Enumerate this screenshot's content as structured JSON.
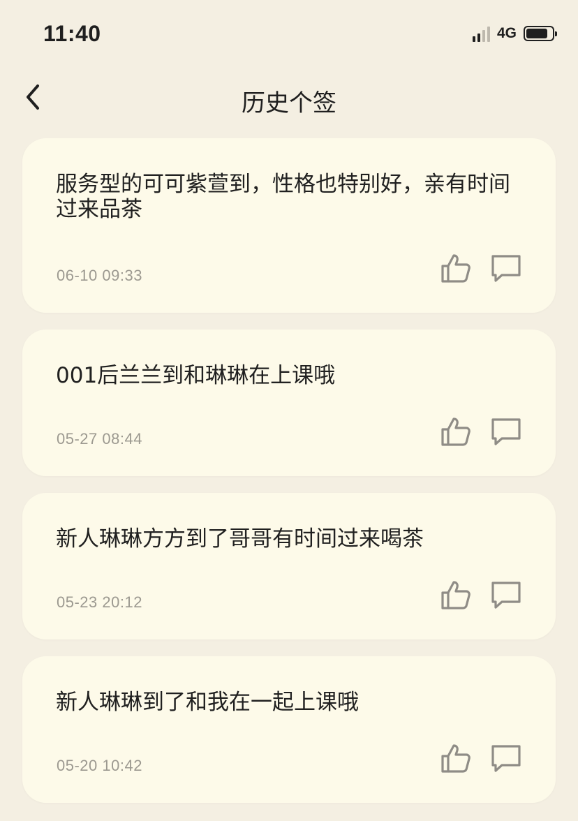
{
  "status_bar": {
    "time": "11:40",
    "network": "4G"
  },
  "header": {
    "title": "历史个签"
  },
  "icons": {
    "back": "chevron-left-icon",
    "like": "thumbs-up-icon",
    "comment": "comment-icon"
  },
  "colors": {
    "background": "#f4efe2",
    "card": "#fdfae9",
    "date_text": "#9c9990",
    "icon_gray": "#8f8c86"
  },
  "signatures": [
    {
      "text": "服务型的可可紫萱到，性格也特别好，亲有时间过来品茶",
      "date": "06-10 09:33"
    },
    {
      "text": "001后兰兰到和琳琳在上课哦",
      "date": "05-27 08:44"
    },
    {
      "text": "新人琳琳方方到了哥哥有时间过来喝茶",
      "date": "05-23 20:12"
    },
    {
      "text": "新人琳琳到了和我在一起上课哦",
      "date": "05-20 10:42"
    }
  ]
}
